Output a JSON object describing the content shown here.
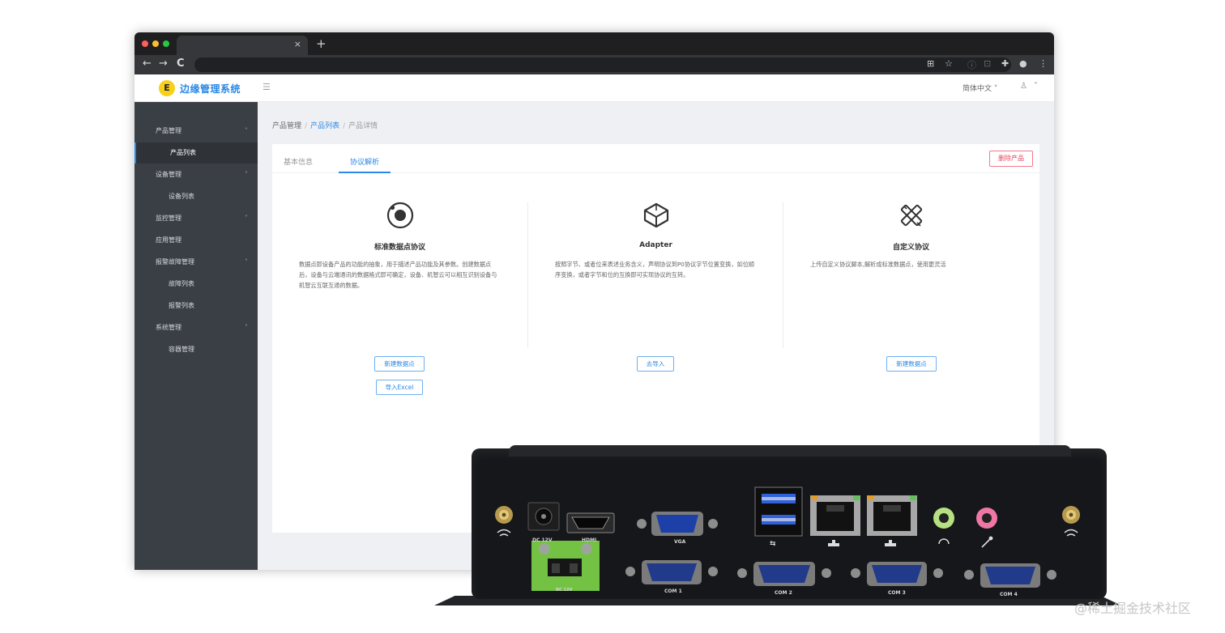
{
  "browser": {
    "tab_close": "×",
    "new_tab": "+",
    "nav": {
      "back": "←",
      "forward": "→",
      "reload": "C"
    },
    "toolbar_icons": [
      "translate-icon",
      "star-icon",
      "info-icon",
      "media-icon",
      "extensions-icon",
      "profile-icon",
      "menu-icon"
    ]
  },
  "app": {
    "logo_letter": "E",
    "title": "边缘管理系统",
    "language": "简体中文",
    "accent_color": "#2b88e6"
  },
  "sidebar": {
    "items": [
      {
        "label": "产品管理",
        "level": 1,
        "arrow": "˄"
      },
      {
        "label": "产品列表",
        "level": 2,
        "active": true
      },
      {
        "label": "设备管理",
        "level": 1,
        "arrow": "˄"
      },
      {
        "label": "设备列表",
        "level": 2
      },
      {
        "label": "监控管理",
        "level": 1,
        "arrow": "˅"
      },
      {
        "label": "应用管理",
        "level": 1
      },
      {
        "label": "报警故障管理",
        "level": 1,
        "arrow": "˄"
      },
      {
        "label": "故障列表",
        "level": 2
      },
      {
        "label": "报警列表",
        "level": 2
      },
      {
        "label": "系统管理",
        "level": 1,
        "arrow": "˄"
      },
      {
        "label": "容器管理",
        "level": 2
      }
    ]
  },
  "breadcrumb": {
    "items": [
      "产品管理",
      "产品列表",
      "产品详情"
    ],
    "sep": "/"
  },
  "detail": {
    "tabs": [
      {
        "label": "基本信息"
      },
      {
        "label": "协议解析",
        "active": true
      }
    ],
    "delete_button": "删除产品",
    "columns": [
      {
        "icon": "target-icon",
        "title": "标准数据点协议",
        "description": "数据点即设备产品的功能的抽象，用于描述产品功能及其参数。创建数据点后，设备与云端通讯的数据格式即可确定，设备、机智云可以相互识别设备与机智云互联互通的数据。",
        "buttons": [
          "新建数据点",
          "导入Excel"
        ]
      },
      {
        "icon": "cube-icon",
        "title": "Adapter",
        "description": "按照字节、或者位来表述业务含义，声明协议到P0协议字节位置变换，如位顺序变换，或者字节和位的互换即可实现协议的互转。",
        "buttons": [
          "去导入"
        ]
      },
      {
        "icon": "tools-icon",
        "title": "自定义协议",
        "description": "上传自定义协议脚本,解析成标准数据点，使用更灵活",
        "buttons": [
          "新建数据点"
        ]
      }
    ]
  },
  "device": {
    "labels": {
      "dc12v": "DC 12V",
      "hdmi": "HDMI",
      "vga": "VGA",
      "usb": "⇆",
      "com1": "COM 1",
      "com2": "COM 2",
      "com3": "COM 3",
      "com4": "COM 4",
      "dc_terminal": "DC 12V"
    }
  },
  "watermark": "@稀土掘金技术社区"
}
